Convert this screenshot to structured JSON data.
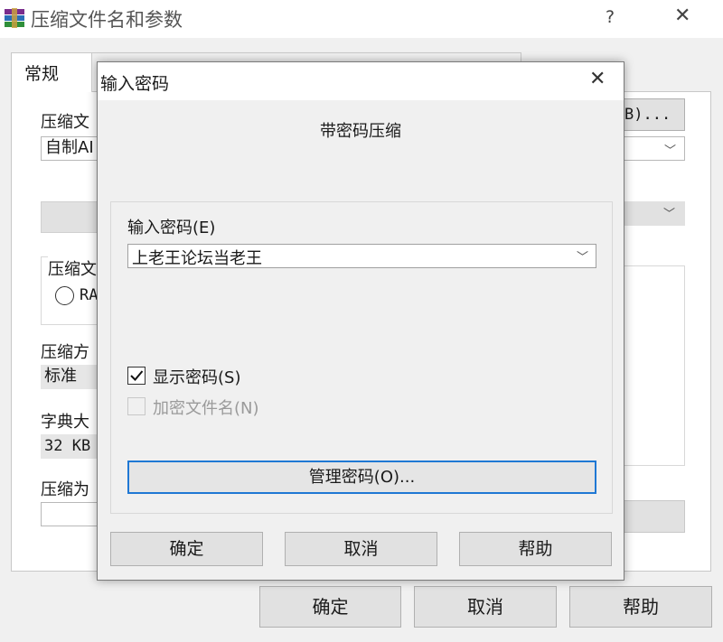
{
  "window": {
    "title": "压缩文件名和参数",
    "help_glyph": "?",
    "close_glyph": "✕",
    "tabs": [
      {
        "label": "常规"
      }
    ]
  },
  "background_panel": {
    "archive_name_label": "压缩文",
    "archive_name_value": "自制AI",
    "browse_button_fragment": "B)...",
    "format_group_label": "压缩文",
    "format_radio_fragment": "RA",
    "method_label": "压缩方",
    "method_value": "标准",
    "dictionary_label": "字典大",
    "dictionary_value": "32 KB",
    "split_label": "压缩为"
  },
  "bottom_buttons": {
    "ok": "确定",
    "cancel": "取消",
    "help": "帮助"
  },
  "dialog": {
    "title": "输入密码",
    "close_glyph": "✕",
    "heading": "带密码压缩",
    "password_label": "输入密码(E)",
    "password_value": "上老王论坛当老王",
    "show_password": {
      "label": "显示密码(S)",
      "checked": true
    },
    "encrypt_filenames": {
      "label": "加密文件名(N)",
      "checked": false,
      "disabled": true
    },
    "manage_button": "管理密码(O)...",
    "buttons": {
      "ok": "确定",
      "cancel": "取消",
      "help": "帮助"
    }
  },
  "colors": {
    "focus_border": "#1f78d4",
    "dialog_bg": "#f0f0f0"
  }
}
